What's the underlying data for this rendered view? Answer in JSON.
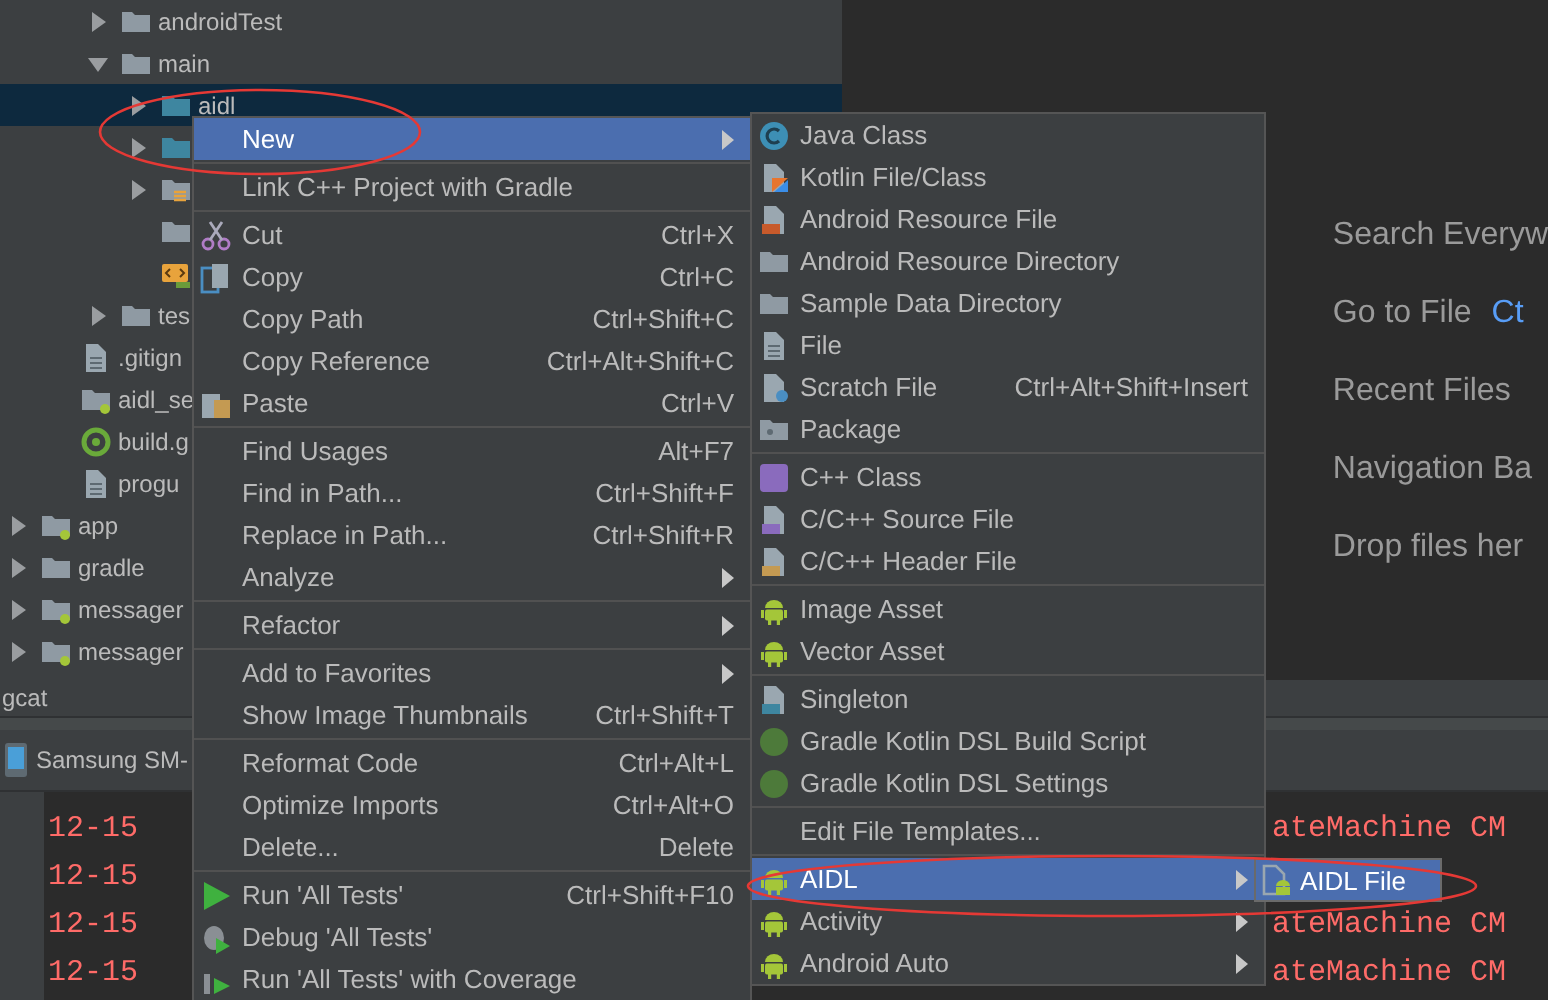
{
  "tree": {
    "items": [
      {
        "children": [
          {
            "children": [
              {
                "label": "androidTest",
                "kind": "folder",
                "expanded": false,
                "selected": false
              },
              {
                "label": "main",
                "kind": "folder",
                "expanded": true,
                "selected": false,
                "children": [
                  {
                    "label": "aidl",
                    "kind": "source-folder",
                    "expanded": false,
                    "selected": true
                  },
                  {
                    "kind": "source-folder",
                    "expanded": false,
                    "selected": false
                  },
                  {
                    "kind": "resource-folder",
                    "expanded": false,
                    "selected": false
                  },
                  {
                    "kind": "folder",
                    "selected": false
                  },
                  {
                    "kind": "manifest",
                    "selected": false
                  }
                ]
              },
              {
                "label": "tes",
                "kind": "folder",
                "expanded": false,
                "selected": false
              }
            ]
          },
          {
            "label": ".gitign",
            "kind": "file",
            "selected": false
          },
          {
            "label": "aidl_se",
            "kind": "module",
            "selected": false
          },
          {
            "label": "build.g",
            "kind": "gradle",
            "selected": false
          },
          {
            "label": "progu",
            "kind": "file",
            "selected": false
          }
        ]
      },
      {
        "label": "app",
        "kind": "module",
        "expanded": false,
        "selected": false
      },
      {
        "label": "gradle",
        "kind": "folder",
        "expanded": false,
        "selected": false
      },
      {
        "label": "messager",
        "kind": "module",
        "expanded": false,
        "selected": false
      },
      {
        "label": "messager",
        "kind": "module",
        "expanded": false,
        "selected": false
      }
    ]
  },
  "editor_hints": [
    {
      "label": "Search Everyw"
    },
    {
      "label": "Go to File",
      "shortcut": "Ct"
    },
    {
      "label": "Recent Files"
    },
    {
      "label": "Navigation Ba"
    },
    {
      "label": "Drop files her"
    }
  ],
  "logcat": {
    "title": "gcat",
    "device": "Samsung SM-",
    "lines": [
      {
        "left": "12-15",
        "right": "ateMachine CM"
      },
      {
        "left": "12-15"
      },
      {
        "left": "12-15",
        "right": "ateMachine CM"
      },
      {
        "left": "12-15",
        "right": "ateMachine CM"
      }
    ]
  },
  "context_menu": {
    "items": [
      {
        "kind": "plain",
        "label": "New",
        "submenu": true,
        "selected": true
      },
      {
        "kind": "separator"
      },
      {
        "kind": "plain",
        "label": "Link C++ Project with Gradle",
        "selected": false
      },
      {
        "kind": "separator"
      },
      {
        "kind": "scissors",
        "label": "Cut",
        "shortcut": "Ctrl+X",
        "selected": false
      },
      {
        "kind": "copy",
        "label": "Copy",
        "shortcut": "Ctrl+C",
        "selected": false
      },
      {
        "kind": "plain",
        "label": "Copy Path",
        "shortcut": "Ctrl+Shift+C",
        "selected": false
      },
      {
        "kind": "plain",
        "label": "Copy Reference",
        "shortcut": "Ctrl+Alt+Shift+C",
        "selected": false
      },
      {
        "kind": "paste",
        "label": "Paste",
        "shortcut": "Ctrl+V",
        "selected": false
      },
      {
        "kind": "separator"
      },
      {
        "kind": "plain",
        "label": "Find Usages",
        "shortcut": "Alt+F7",
        "selected": false
      },
      {
        "kind": "plain",
        "label": "Find in Path...",
        "shortcut": "Ctrl+Shift+F",
        "selected": false
      },
      {
        "kind": "plain",
        "label": "Replace in Path...",
        "shortcut": "Ctrl+Shift+R",
        "selected": false
      },
      {
        "kind": "plain",
        "label": "Analyze",
        "submenu": true,
        "selected": false
      },
      {
        "kind": "separator"
      },
      {
        "kind": "plain",
        "label": "Refactor",
        "submenu": true,
        "selected": false
      },
      {
        "kind": "separator"
      },
      {
        "kind": "plain",
        "label": "Add to Favorites",
        "submenu": true,
        "selected": false
      },
      {
        "kind": "plain",
        "label": "Show Image Thumbnails",
        "shortcut": "Ctrl+Shift+T",
        "selected": false
      },
      {
        "kind": "separator"
      },
      {
        "kind": "plain",
        "label": "Reformat Code",
        "shortcut": "Ctrl+Alt+L",
        "selected": false
      },
      {
        "kind": "plain",
        "label": "Optimize Imports",
        "shortcut": "Ctrl+Alt+O",
        "selected": false
      },
      {
        "kind": "plain",
        "label": "Delete...",
        "shortcut": "Delete",
        "selected": false
      },
      {
        "kind": "separator"
      },
      {
        "kind": "run",
        "label": "Run 'All Tests'",
        "shortcut": "Ctrl+Shift+F10",
        "selected": false
      },
      {
        "kind": "debug",
        "label": "Debug 'All Tests'",
        "selected": false
      },
      {
        "kind": "coverage",
        "label": "Run 'All Tests' with Coverage",
        "selected": false
      }
    ]
  },
  "new_submenu": {
    "items": [
      {
        "kind": "class",
        "label": "Java Class",
        "selected": false
      },
      {
        "kind": "kotlin",
        "label": "Kotlin File/Class",
        "selected": false
      },
      {
        "kind": "resource-file",
        "label": "Android Resource File",
        "selected": false
      },
      {
        "kind": "directory",
        "label": "Android Resource Directory",
        "selected": false
      },
      {
        "kind": "directory",
        "label": "Sample Data Directory",
        "selected": false
      },
      {
        "kind": "file",
        "label": "File",
        "selected": false
      },
      {
        "kind": "scratch",
        "label": "Scratch File",
        "shortcut": "Ctrl+Alt+Shift+Insert",
        "selected": false
      },
      {
        "kind": "package",
        "label": "Package",
        "selected": false
      },
      {
        "kind": "separator"
      },
      {
        "kind": "cpp-class",
        "label": "C++ Class",
        "selected": false
      },
      {
        "kind": "cpp-source",
        "label": "C/C++ Source File",
        "selected": false
      },
      {
        "kind": "cpp-header",
        "label": "C/C++ Header File",
        "selected": false
      },
      {
        "kind": "separator"
      },
      {
        "kind": "android",
        "label": "Image Asset",
        "selected": false
      },
      {
        "kind": "android",
        "label": "Vector Asset",
        "selected": false
      },
      {
        "kind": "separator"
      },
      {
        "kind": "singleton",
        "label": "Singleton",
        "selected": false
      },
      {
        "kind": "gradle-circle",
        "label": "Gradle Kotlin DSL Build Script",
        "selected": false
      },
      {
        "kind": "gradle-circle",
        "label": "Gradle Kotlin DSL Settings",
        "selected": false
      },
      {
        "kind": "separator"
      },
      {
        "kind": "plain",
        "label": "Edit File Templates...",
        "selected": false
      },
      {
        "kind": "separator"
      },
      {
        "kind": "android",
        "label": "AIDL",
        "submenu": true,
        "selected": true
      },
      {
        "kind": "android",
        "label": "Activity",
        "submenu": true,
        "selected": false
      },
      {
        "kind": "android",
        "label": "Android Auto",
        "submenu": true,
        "selected": false
      }
    ]
  },
  "aidl_submenu": {
    "items": [
      {
        "kind": "aidl-file",
        "label": "AIDL File",
        "selected": true
      }
    ]
  }
}
